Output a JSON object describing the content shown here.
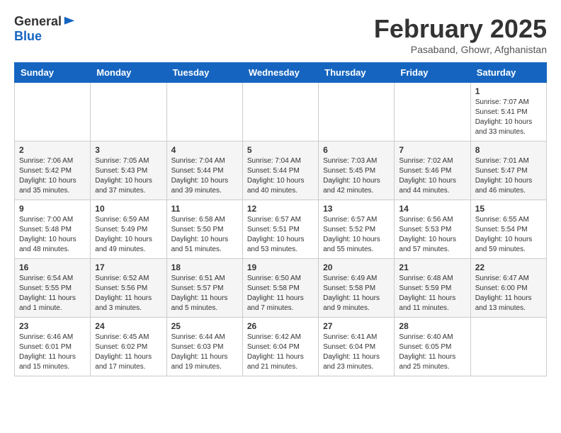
{
  "header": {
    "logo_line1": "General",
    "logo_line2": "Blue",
    "month_year": "February 2025",
    "location": "Pasaband, Ghowr, Afghanistan"
  },
  "days_of_week": [
    "Sunday",
    "Monday",
    "Tuesday",
    "Wednesday",
    "Thursday",
    "Friday",
    "Saturday"
  ],
  "weeks": [
    [
      {
        "day": "",
        "info": ""
      },
      {
        "day": "",
        "info": ""
      },
      {
        "day": "",
        "info": ""
      },
      {
        "day": "",
        "info": ""
      },
      {
        "day": "",
        "info": ""
      },
      {
        "day": "",
        "info": ""
      },
      {
        "day": "1",
        "info": "Sunrise: 7:07 AM\nSunset: 5:41 PM\nDaylight: 10 hours\nand 33 minutes."
      }
    ],
    [
      {
        "day": "2",
        "info": "Sunrise: 7:06 AM\nSunset: 5:42 PM\nDaylight: 10 hours\nand 35 minutes."
      },
      {
        "day": "3",
        "info": "Sunrise: 7:05 AM\nSunset: 5:43 PM\nDaylight: 10 hours\nand 37 minutes."
      },
      {
        "day": "4",
        "info": "Sunrise: 7:04 AM\nSunset: 5:44 PM\nDaylight: 10 hours\nand 39 minutes."
      },
      {
        "day": "5",
        "info": "Sunrise: 7:04 AM\nSunset: 5:44 PM\nDaylight: 10 hours\nand 40 minutes."
      },
      {
        "day": "6",
        "info": "Sunrise: 7:03 AM\nSunset: 5:45 PM\nDaylight: 10 hours\nand 42 minutes."
      },
      {
        "day": "7",
        "info": "Sunrise: 7:02 AM\nSunset: 5:46 PM\nDaylight: 10 hours\nand 44 minutes."
      },
      {
        "day": "8",
        "info": "Sunrise: 7:01 AM\nSunset: 5:47 PM\nDaylight: 10 hours\nand 46 minutes."
      }
    ],
    [
      {
        "day": "9",
        "info": "Sunrise: 7:00 AM\nSunset: 5:48 PM\nDaylight: 10 hours\nand 48 minutes."
      },
      {
        "day": "10",
        "info": "Sunrise: 6:59 AM\nSunset: 5:49 PM\nDaylight: 10 hours\nand 49 minutes."
      },
      {
        "day": "11",
        "info": "Sunrise: 6:58 AM\nSunset: 5:50 PM\nDaylight: 10 hours\nand 51 minutes."
      },
      {
        "day": "12",
        "info": "Sunrise: 6:57 AM\nSunset: 5:51 PM\nDaylight: 10 hours\nand 53 minutes."
      },
      {
        "day": "13",
        "info": "Sunrise: 6:57 AM\nSunset: 5:52 PM\nDaylight: 10 hours\nand 55 minutes."
      },
      {
        "day": "14",
        "info": "Sunrise: 6:56 AM\nSunset: 5:53 PM\nDaylight: 10 hours\nand 57 minutes."
      },
      {
        "day": "15",
        "info": "Sunrise: 6:55 AM\nSunset: 5:54 PM\nDaylight: 10 hours\nand 59 minutes."
      }
    ],
    [
      {
        "day": "16",
        "info": "Sunrise: 6:54 AM\nSunset: 5:55 PM\nDaylight: 11 hours\nand 1 minute."
      },
      {
        "day": "17",
        "info": "Sunrise: 6:52 AM\nSunset: 5:56 PM\nDaylight: 11 hours\nand 3 minutes."
      },
      {
        "day": "18",
        "info": "Sunrise: 6:51 AM\nSunset: 5:57 PM\nDaylight: 11 hours\nand 5 minutes."
      },
      {
        "day": "19",
        "info": "Sunrise: 6:50 AM\nSunset: 5:58 PM\nDaylight: 11 hours\nand 7 minutes."
      },
      {
        "day": "20",
        "info": "Sunrise: 6:49 AM\nSunset: 5:58 PM\nDaylight: 11 hours\nand 9 minutes."
      },
      {
        "day": "21",
        "info": "Sunrise: 6:48 AM\nSunset: 5:59 PM\nDaylight: 11 hours\nand 11 minutes."
      },
      {
        "day": "22",
        "info": "Sunrise: 6:47 AM\nSunset: 6:00 PM\nDaylight: 11 hours\nand 13 minutes."
      }
    ],
    [
      {
        "day": "23",
        "info": "Sunrise: 6:46 AM\nSunset: 6:01 PM\nDaylight: 11 hours\nand 15 minutes."
      },
      {
        "day": "24",
        "info": "Sunrise: 6:45 AM\nSunset: 6:02 PM\nDaylight: 11 hours\nand 17 minutes."
      },
      {
        "day": "25",
        "info": "Sunrise: 6:44 AM\nSunset: 6:03 PM\nDaylight: 11 hours\nand 19 minutes."
      },
      {
        "day": "26",
        "info": "Sunrise: 6:42 AM\nSunset: 6:04 PM\nDaylight: 11 hours\nand 21 minutes."
      },
      {
        "day": "27",
        "info": "Sunrise: 6:41 AM\nSunset: 6:04 PM\nDaylight: 11 hours\nand 23 minutes."
      },
      {
        "day": "28",
        "info": "Sunrise: 6:40 AM\nSunset: 6:05 PM\nDaylight: 11 hours\nand 25 minutes."
      },
      {
        "day": "",
        "info": ""
      }
    ]
  ]
}
